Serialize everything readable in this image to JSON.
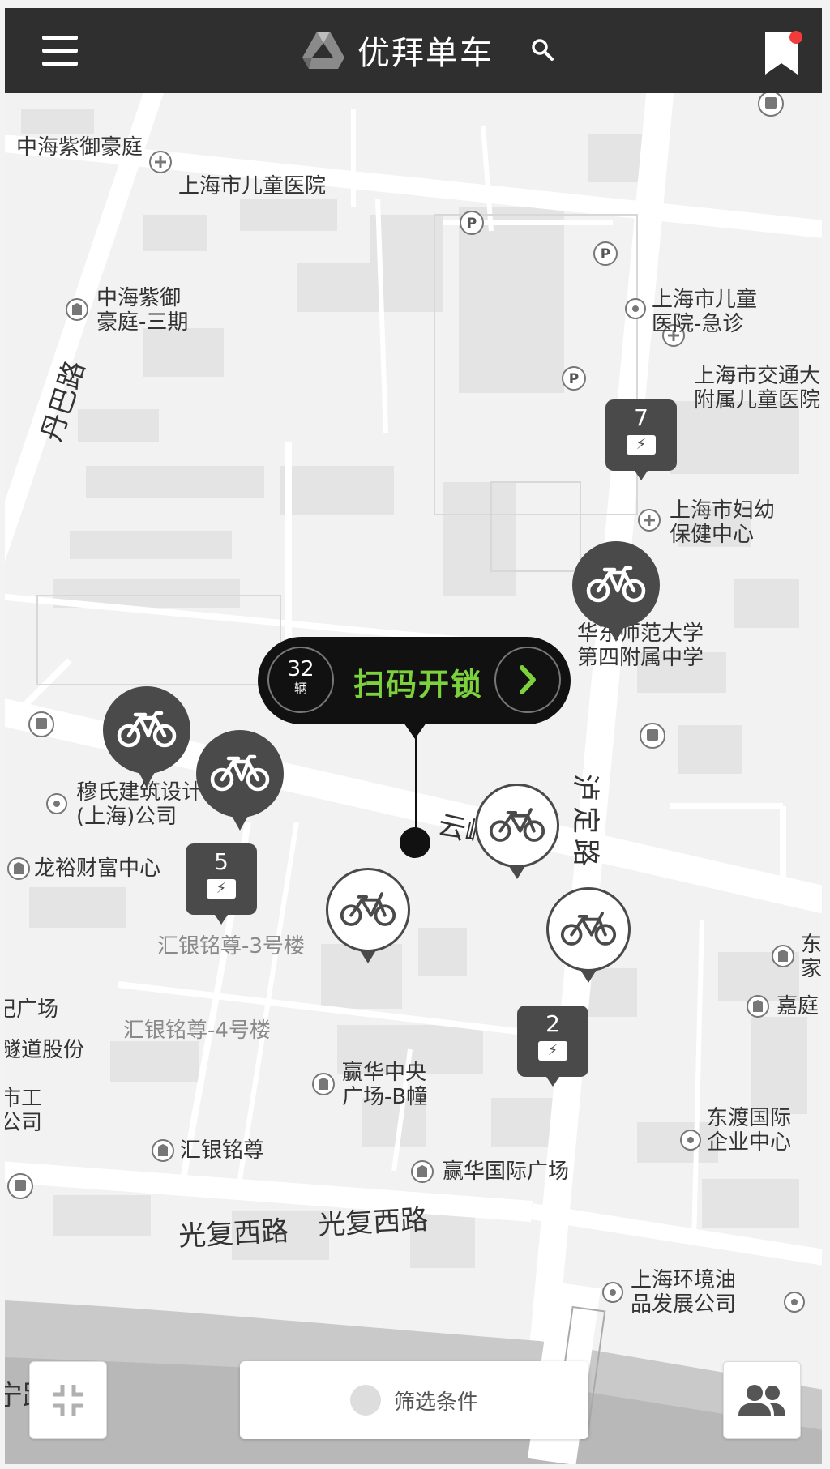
{
  "header": {
    "title": "优拜单车"
  },
  "map": {
    "pois": [
      "中海紫御豪庭",
      "上海市儿童医院",
      "中海紫御",
      "豪庭-三期",
      "上海市儿童",
      "医院-急诊",
      "上海市交通大",
      "附属儿童医院",
      "上海市妇幼",
      "保健中心",
      "华东师范大学",
      "第四附属中学",
      "穆氏建筑设计",
      "(上海)公司",
      "龙裕财富中心",
      "汇银铭尊-3号楼",
      "汇银铭尊-4号楼",
      "赢华中央",
      "广场-B幢",
      "汇银铭尊",
      "赢华国际广场",
      "东渡国际",
      "企业中心",
      "上海环境油",
      "品发展公司",
      "东",
      "家",
      "嘉庭",
      "记广场",
      "隧道股份",
      "市工",
      "公司"
    ],
    "roads": {
      "danba": "丹巴路",
      "yunling": "云岭东路",
      "luding": "泸定路",
      "guangfu1": "光复西路",
      "guangfu2": "光复西路",
      "bottom": "宁路"
    },
    "clusters": [
      {
        "count": "7"
      },
      {
        "count": "5"
      },
      {
        "count": "2"
      }
    ]
  },
  "callout": {
    "count": "32",
    "unit": "辆",
    "action": "扫码开锁"
  },
  "bottom": {
    "filter_label": "筛选条件"
  },
  "icons": {
    "menu": "menu-icon",
    "logo": "logo-icon",
    "search": "search-icon",
    "bookmark": "bookmark-icon",
    "bike": "bike-icon",
    "collapse": "collapse-icon",
    "people": "people-icon"
  },
  "colors": {
    "topbar": "#2f2f2f",
    "accent_green": "#7cd13c",
    "badge_red": "#f23b3b",
    "pin_dark": "#4a4a4a"
  }
}
